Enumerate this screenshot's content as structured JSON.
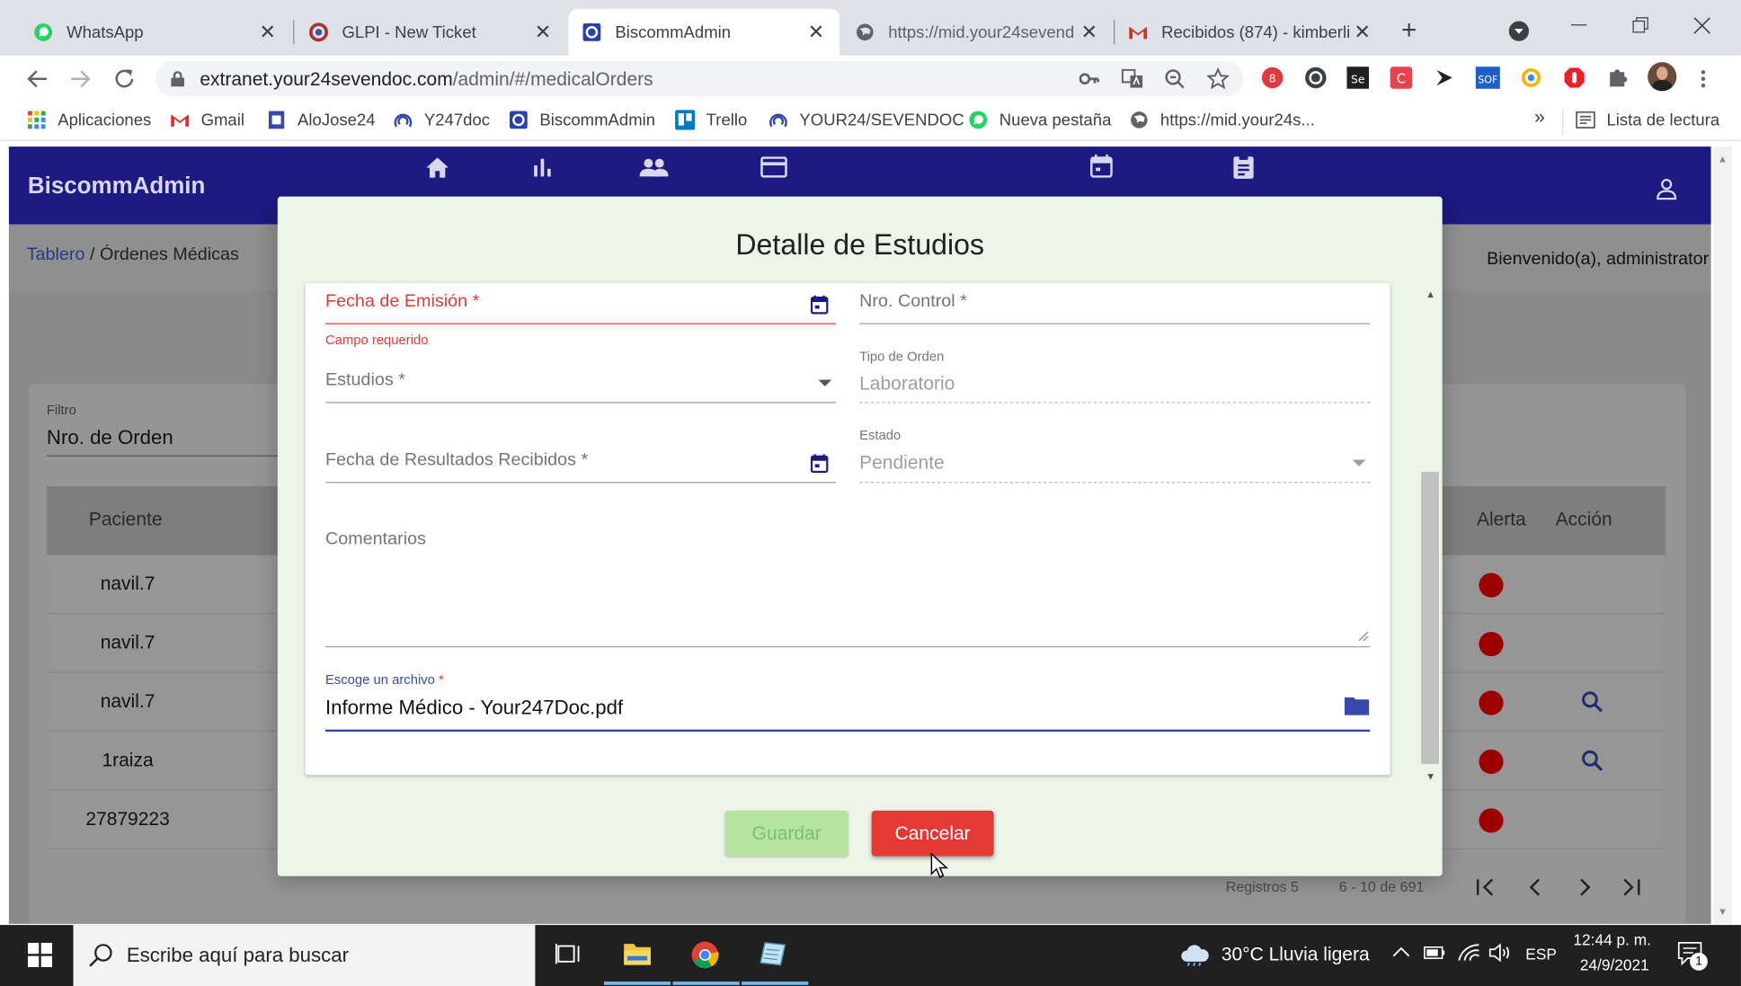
{
  "browser": {
    "tabs": [
      {
        "label": "WhatsApp",
        "icon": "whatsapp-icon"
      },
      {
        "label": "GLPI - New Ticket",
        "icon": "glpi-icon"
      },
      {
        "label": "BiscommAdmin",
        "icon": "biscomm-icon",
        "active": true
      },
      {
        "label": "https://mid.your24sevend",
        "icon": "globe-icon"
      },
      {
        "label": "Recibidos (874) - kimberli",
        "icon": "gmail-icon"
      }
    ],
    "close_glyph": "✕",
    "new_tab_glyph": "+",
    "url_host": "extranet.your24sevendoc.com",
    "url_path": "/admin/#/medicalOrders",
    "bookmarks": [
      {
        "label": "Aplicaciones",
        "icon": "apps-grid-icon"
      },
      {
        "label": "Gmail",
        "icon": "gmail-icon"
      },
      {
        "label": "AloJose24",
        "icon": "page-icon"
      },
      {
        "label": "Y247doc",
        "icon": "your24-icon"
      },
      {
        "label": "BiscommAdmin",
        "icon": "biscomm-icon"
      },
      {
        "label": "Trello",
        "icon": "trello-icon"
      },
      {
        "label": "YOUR24/SEVENDOC",
        "icon": "your24-icon"
      },
      {
        "label": "Nueva pestaña",
        "icon": "whatsapp-icon"
      },
      {
        "label": "https://mid.your24s...",
        "icon": "globe-icon"
      }
    ],
    "more_glyph": "»",
    "reading_list": "Lista de lectura"
  },
  "app": {
    "brand": "BiscommAdmin",
    "breadcrumb_root": "Tablero",
    "breadcrumb_sep": " / ",
    "breadcrumb_current": "Órdenes Médicas",
    "welcome": "Bienvenido(a), administrator",
    "filter_label": "Filtro",
    "filter_value": "Nro. de Orden",
    "table": {
      "columns": {
        "patient": "Paciente",
        "alert": "Alerta",
        "action": "Acción"
      },
      "rows": [
        {
          "patient": "navil.7",
          "has_action": false
        },
        {
          "patient": "navil.7",
          "has_action": false
        },
        {
          "patient": "navil.7",
          "has_action": true
        },
        {
          "patient": "1raiza",
          "has_action": true
        },
        {
          "patient": "27879223",
          "has_action": false
        }
      ]
    },
    "pagination": {
      "records_label": "Registros 5",
      "range": "6 - 10 de 691"
    }
  },
  "modal": {
    "title": "Detalle de Estudios",
    "fields": {
      "fecha_emision": {
        "label": "Fecha de Emisión *",
        "error": "Campo requerido"
      },
      "nro_control": {
        "label": "Nro. Control *"
      },
      "estudios": {
        "label": "Estudios *"
      },
      "tipo_orden": {
        "label": "Tipo de Orden",
        "value": "Laboratorio"
      },
      "fecha_resultados": {
        "label": "Fecha de Resultados Recibidos *"
      },
      "estado": {
        "label": "Estado",
        "value": "Pendiente"
      },
      "comentarios": {
        "label": "Comentarios"
      },
      "archivo": {
        "label": "Escoge un archivo",
        "required_mark": " *",
        "value": "Informe Médico - Your247Doc.pdf"
      }
    },
    "buttons": {
      "save": "Guardar",
      "cancel": "Cancelar"
    }
  },
  "taskbar": {
    "search_placeholder": "Escribe aquí para buscar",
    "weather": "30°C  Lluvia ligera",
    "lang": "ESP",
    "time": "12:44 p. m.",
    "date": "24/9/2021",
    "notif_count": "1"
  },
  "colors": {
    "app_bar": "#1d1a82",
    "error": "#e53935",
    "accent": "#3949ab",
    "alert_dot": "#9c0000",
    "save_button": "#b5e3a0",
    "cancel_button": "#e53935"
  }
}
